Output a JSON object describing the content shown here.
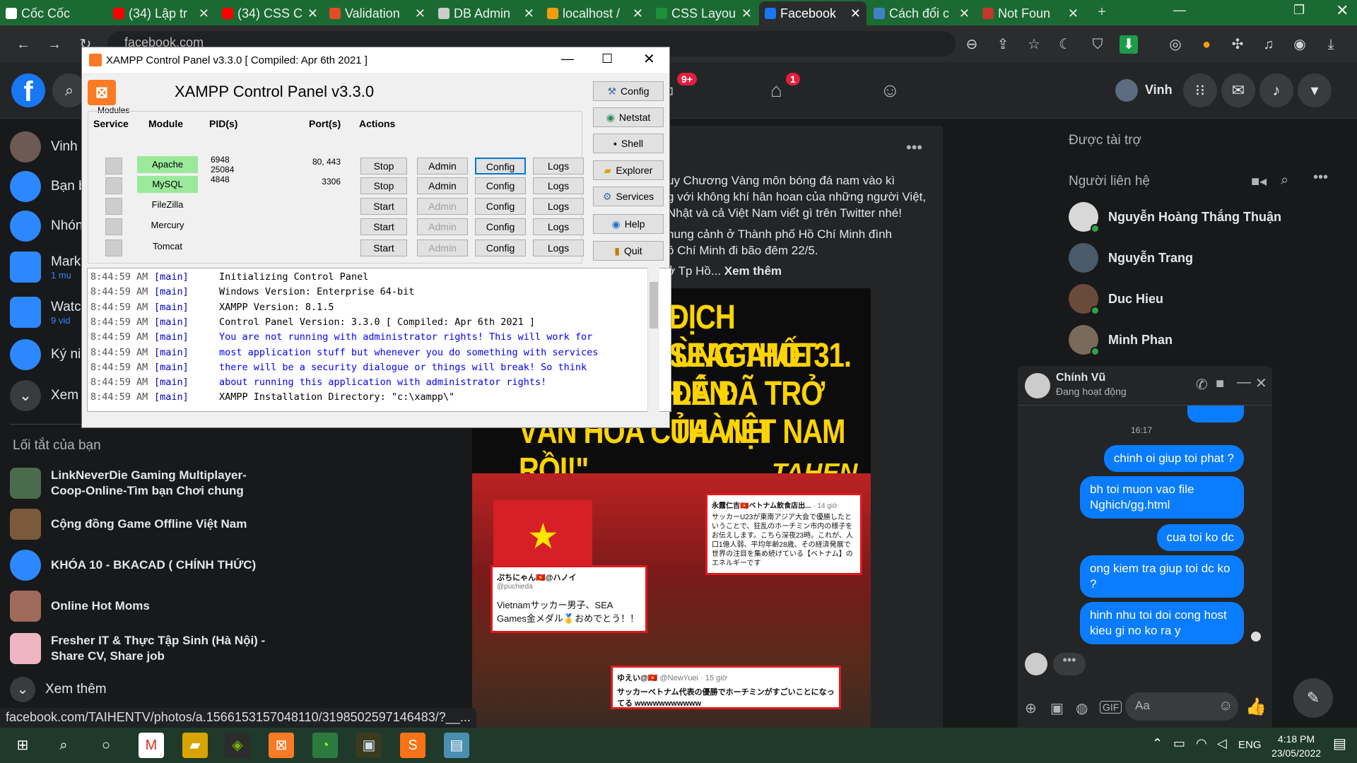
{
  "browser": {
    "tabs": [
      {
        "title": "Cốc Cốc",
        "color": "#ffffff"
      },
      {
        "title": "(34) Lập tr",
        "color": "#ff0000"
      },
      {
        "title": "(34) CSS C",
        "color": "#ff0000"
      },
      {
        "title": "Validation",
        "color": "#e34c26"
      },
      {
        "title": "DB Admin",
        "color": "#cccccc"
      },
      {
        "title": "localhost /",
        "color": "#f39c12"
      },
      {
        "title": "CSS Layou",
        "color": "#1e8f3a"
      },
      {
        "title": "Facebook",
        "color": "#1877f2"
      },
      {
        "title": "Cách đổi c",
        "color": "#3e83c8"
      },
      {
        "title": "Not Foun",
        "color": "#c0392b"
      }
    ],
    "url": "facebook.com",
    "status_url": "facebook.com/TAIHENTV/photos/a.1566153157048110/3198502597146483/?__..."
  },
  "fb": {
    "user_name": "Vinh",
    "badges": {
      "video": "9+",
      "marketplace": "1"
    },
    "sidebar": [
      {
        "label": "Vinh",
        "sub": ""
      },
      {
        "label": "Bạn b",
        "sub": ""
      },
      {
        "label": "Nhón",
        "sub": ""
      },
      {
        "label": "Marke",
        "sub": "1 mu"
      },
      {
        "label": "Watcl",
        "sub": "9 vid"
      },
      {
        "label": "Ký niệ",
        "sub": ""
      },
      {
        "label": "Xem t",
        "sub": ""
      }
    ],
    "shortcuts_title": "Lối tắt của bạn",
    "shortcuts": [
      "LinkNeverDie Gaming Multiplayer-Coop-Online-Tìm bạn Chơi chung",
      "Cộng đồng Game Offline Việt Nam",
      "KHÓA 10 - BKACAD ( CHÍNH THỨC)",
      "Online Hot Moms",
      "Fresher IT & Thực Tập Sinh (Hà Nội) - Share CV, Share job"
    ],
    "see_more": "Xem thêm",
    "post": {
      "text_lines": [
        "uy Chương Vàng môn bóng đá nam vào kì",
        "g với không khí hân hoan của những người Việt,",
        "Nhật và cả Việt Nam viết gì trên Twitter nhé!"
      ],
      "text2_lines": [
        "hung cảnh ở Thành phố Hồ Chí Minh đình",
        "ồ Chí Minh đi bão đêm 22/5."
      ],
      "text3": "ở Tp Hồ...",
      "see_more": "Xem thêm",
      "poster_lines": [
        "ĐỊCH SEAGAME 31.",
        "ÙNG THỐT LÊN:",
        "ĐÁ ĐÃ TRỞ THÀNH",
        "VĂN HÓA CỦA VIỆT NAM RỒI!\""
      ],
      "poster_brand": "TAHEN",
      "tweets": [
        {
          "name": "永露仁吉🇻🇳ベトナム飲食店出...",
          "time": "· 14 giờ",
          "body": "サッカーU23が東南アジア大会で優勝したということで、狂乱のホーチミン市内の様子をお伝えします。こちら深夜23時。これが、人口1億人弱、平均年齢28歳、その経済発展で世界の注目を集め続けている【ベトナム】のエネルギーです"
        },
        {
          "name": "ぷちにゃん🇻🇳@ハノイ",
          "handle": "@puchieda",
          "body": "Vietnamサッカー男子、SEA Games金メダル🥇おめでとう！！"
        },
        {
          "name": "ゆえい@🇻🇳",
          "handle": "@NewYuei · 15 giờ",
          "body": "サッカーベトナム代表の優勝でホーチミンがすごいことになってる wwwwwwwwwww"
        }
      ]
    },
    "sponsored_title": "Được tài trợ",
    "contacts_title": "Người liên hệ",
    "contacts": [
      "Nguyễn Hoàng Thắng Thuận",
      "Nguyễn Trang",
      "Duc Hieu",
      "Minh Phan"
    ],
    "chat": {
      "name": "Chính Vũ",
      "status": "Đang hoạt động",
      "time": "16:17",
      "messages": [
        "chinh oi giup toi phat ?",
        "bh toi muon vao file Nghich/gg.html",
        "cua toi ko dc",
        "ong kiem tra giup toi dc ko ?",
        "hinh nhu toi doi cong host kieu gi no ko ra y"
      ],
      "input_placeholder": "Aa"
    }
  },
  "xampp": {
    "title": "XAMPP Control Panel v3.3.0   [ Compiled: Apr 6th 2021 ]",
    "header": "XAMPP Control Panel v3.3.0",
    "col_modules": "Modules",
    "col_service": "Service",
    "col_module": "Module",
    "col_pid": "PID(s)",
    "col_port": "Port(s)",
    "col_actions": "Actions",
    "modules": [
      {
        "name": "Apache",
        "pid": "6948\n25084",
        "port": "80, 443",
        "action": "Stop",
        "admin_enabled": true,
        "running": true
      },
      {
        "name": "MySQL",
        "pid": "4848",
        "port": "3306",
        "action": "Stop",
        "admin_enabled": true,
        "running": true
      },
      {
        "name": "FileZilla",
        "pid": "",
        "port": "",
        "action": "Start",
        "admin_enabled": false,
        "running": false
      },
      {
        "name": "Mercury",
        "pid": "",
        "port": "",
        "action": "Start",
        "admin_enabled": false,
        "running": false
      },
      {
        "name": "Tomcat",
        "pid": "",
        "port": "",
        "action": "Start",
        "admin_enabled": false,
        "running": false
      }
    ],
    "btn_admin": "Admin",
    "btn_config": "Config",
    "btn_logs": "Logs",
    "side_buttons": [
      "Config",
      "Netstat",
      "Shell",
      "Explorer",
      "Services",
      "Help",
      "Quit"
    ],
    "log": [
      {
        "time": "8:44:59 AM",
        "src": "[main]",
        "msg": "Initializing Control Panel",
        "warn": false
      },
      {
        "time": "8:44:59 AM",
        "src": "[main]",
        "msg": "Windows Version:  Enterprise  64-bit",
        "warn": false
      },
      {
        "time": "8:44:59 AM",
        "src": "[main]",
        "msg": "XAMPP Version: 8.1.5",
        "warn": false
      },
      {
        "time": "8:44:59 AM",
        "src": "[main]",
        "msg": "Control Panel Version: 3.3.0  [ Compiled: Apr 6th 2021 ]",
        "warn": false
      },
      {
        "time": "8:44:59 AM",
        "src": "[main]",
        "msg": "You are not running with administrator rights! This will work for",
        "warn": true
      },
      {
        "time": "8:44:59 AM",
        "src": "[main]",
        "msg": "most application stuff but whenever you do something with services",
        "warn": true
      },
      {
        "time": "8:44:59 AM",
        "src": "[main]",
        "msg": "there will be a security dialogue or things will break! So think",
        "warn": true
      },
      {
        "time": "8:44:59 AM",
        "src": "[main]",
        "msg": "about running this application with administrator rights!",
        "warn": true
      },
      {
        "time": "8:44:59 AM",
        "src": "[main]",
        "msg": "XAMPP Installation Directory: \"c:\\xampp\\\"",
        "warn": false
      }
    ]
  },
  "taskbar": {
    "lang": "ENG",
    "time": "4:18 PM",
    "date": "23/05/2022"
  }
}
